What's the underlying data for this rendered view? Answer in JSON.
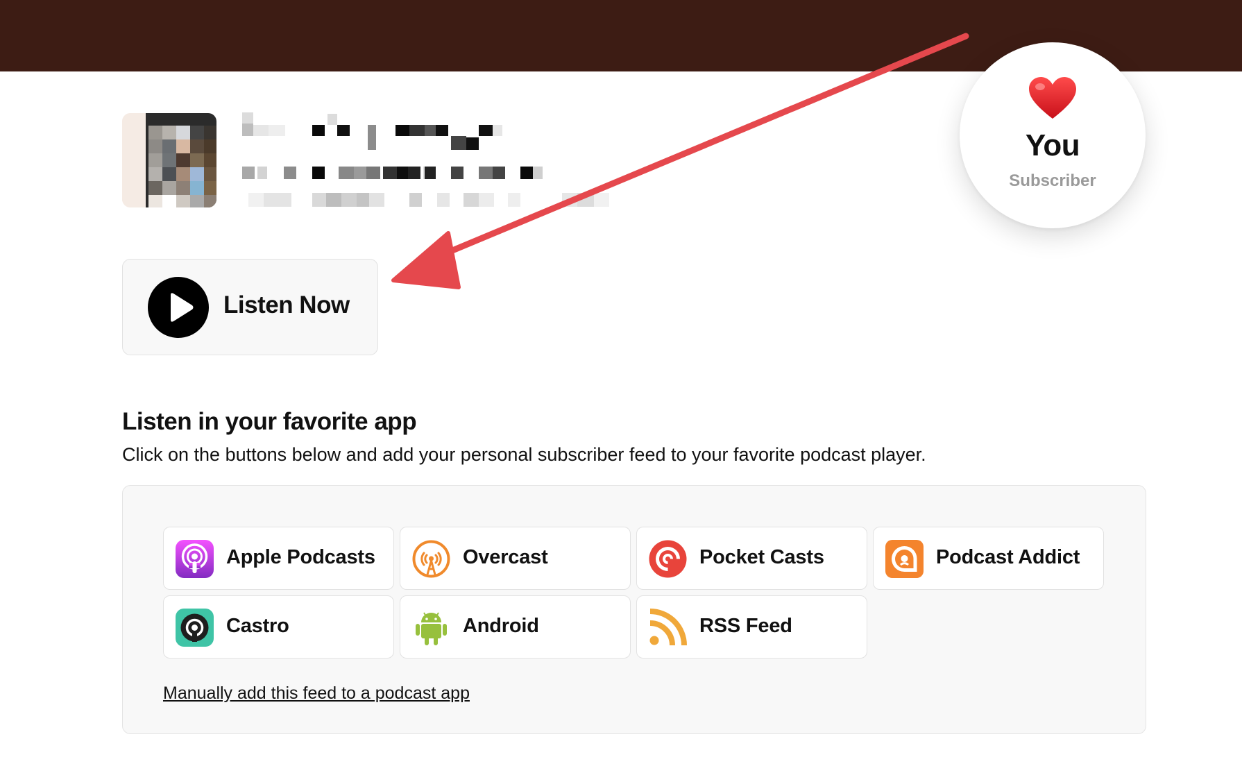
{
  "header": {
    "bar_color": "#3d1c14"
  },
  "subscriber_badge": {
    "emoji": "❤️",
    "name": "You",
    "role": "Subscriber"
  },
  "listen_now": {
    "label": "Listen Now",
    "icon": "play-icon"
  },
  "apps_section": {
    "title": "Listen in your favorite app",
    "description": "Click on the buttons below and add your personal subscriber feed to your favorite podcast player.",
    "apps": [
      {
        "label": "Apple Podcasts",
        "icon": "apple-podcasts-icon"
      },
      {
        "label": "Overcast",
        "icon": "overcast-icon"
      },
      {
        "label": "Pocket Casts",
        "icon": "pocket-casts-icon"
      },
      {
        "label": "Podcast Addict",
        "icon": "podcast-addict-icon"
      },
      {
        "label": "Castro",
        "icon": "castro-icon"
      },
      {
        "label": "Android",
        "icon": "android-icon"
      },
      {
        "label": "RSS Feed",
        "icon": "rss-icon"
      }
    ],
    "manual_link": "Manually add this feed to a podcast app"
  },
  "annotation": {
    "arrow_color": "#e5484d"
  }
}
